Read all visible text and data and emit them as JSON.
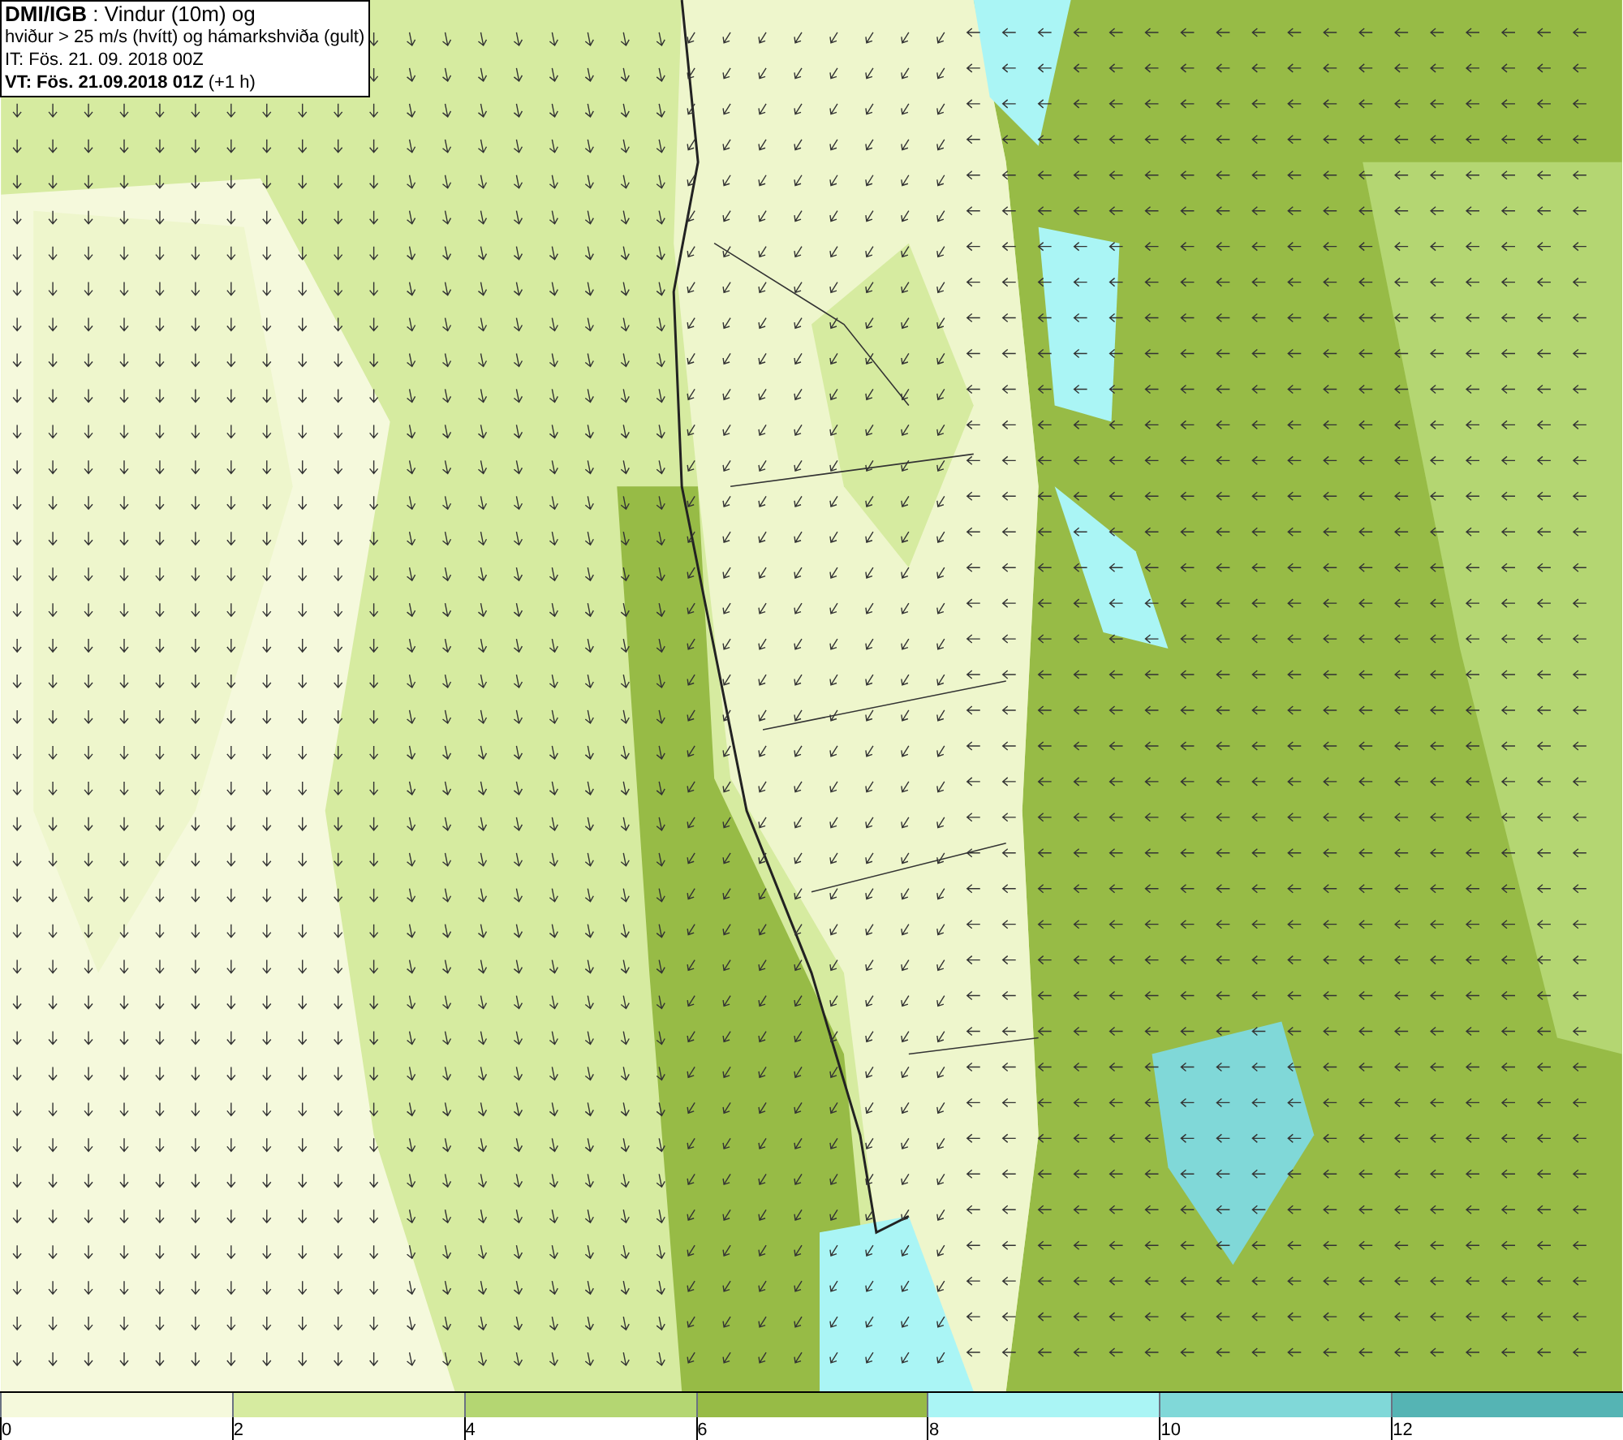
{
  "header": {
    "lines": [
      "**DMI/IGB** : Vindur (10m) og",
      "hviður > 25 m/s (hvítt) og hámarkshviða (gult)",
      "IT: Fös. 21. 09. 2018 00Z",
      "**VT: Fös. 21.09.2018 01Z** (+1 h)"
    ]
  },
  "legend": {
    "bins": [
      {
        "color": "#f5f9dc"
      },
      {
        "color": "#d6eba0"
      },
      {
        "color": "#b4d672"
      },
      {
        "color": "#97bb46"
      },
      {
        "color": "#aaf5f5"
      },
      {
        "color": "#80d8d8"
      },
      {
        "color": "#55b4b4"
      }
    ],
    "ticks": [
      "0",
      "2",
      "4",
      "6",
      "8",
      "10",
      "12"
    ]
  }
}
